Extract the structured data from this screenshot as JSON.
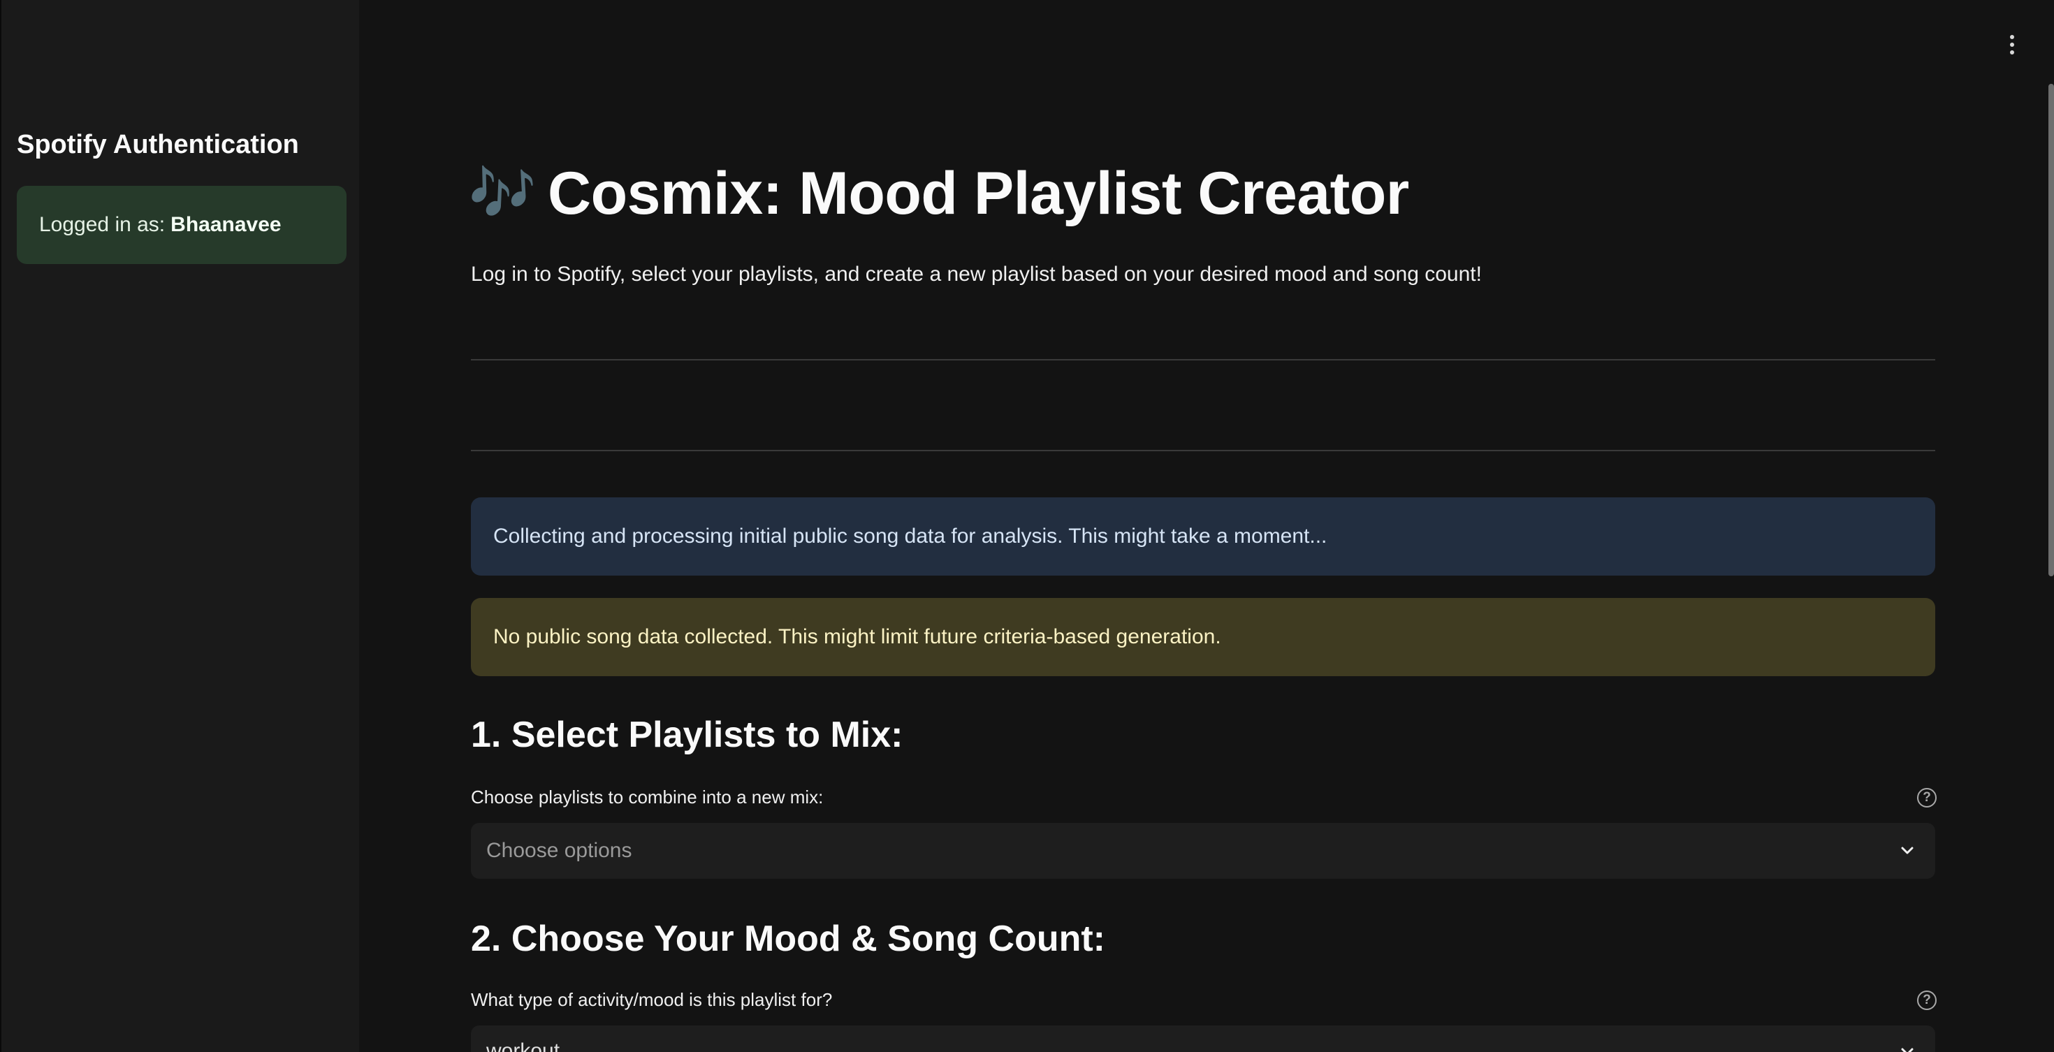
{
  "sidebar": {
    "title": "Spotify Authentication",
    "login_prefix": "Logged in as:",
    "username": "Bhaanavee"
  },
  "header": {
    "menu_icon": "kebab-menu-icon"
  },
  "main": {
    "title_icon": "musical-notes-icon",
    "title_icon_glyph": "🎶",
    "title": "Cosmix: Mood Playlist Creator",
    "subtitle": "Log in to Spotify, select your playlists, and create a new playlist based on your desired mood and song count!",
    "info_alert": "Collecting and processing initial public song data for analysis. This might take a moment...",
    "warning_alert": "No public song data collected. This might limit future criteria-based generation.",
    "section1": {
      "title": "1. Select Playlists to Mix:",
      "label": "Choose playlists to combine into a new mix:",
      "placeholder": "Choose options"
    },
    "section2": {
      "title": "2. Choose Your Mood & Song Count:",
      "label": "What type of activity/mood is this playlist for?",
      "value": "workout"
    }
  },
  "colors": {
    "background": "#131313",
    "sidebar": "#1a1a1a",
    "success_bg": "#263a2a",
    "info_bg": "#222e40",
    "warning_bg": "#3f3b21"
  }
}
